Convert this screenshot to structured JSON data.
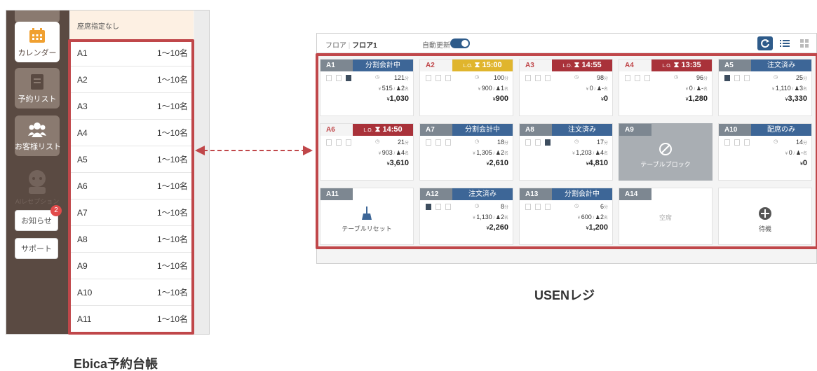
{
  "ebica": {
    "caption": "Ebica予約台帳",
    "sidebar": {
      "calendar": "カレンダー",
      "reservations": "予約リスト",
      "customers": "お客様リスト",
      "ai": "AIレセプション",
      "notice": "お知らせ",
      "notice_badge": "2",
      "support": "サポート"
    },
    "no_seat": "座席指定なし",
    "seats": [
      {
        "name": "A1",
        "capacity": "1〜10名"
      },
      {
        "name": "A2",
        "capacity": "1〜10名"
      },
      {
        "name": "A3",
        "capacity": "1〜10名"
      },
      {
        "name": "A4",
        "capacity": "1〜10名"
      },
      {
        "name": "A5",
        "capacity": "1〜10名"
      },
      {
        "name": "A6",
        "capacity": "1〜10名"
      },
      {
        "name": "A7",
        "capacity": "1〜10名"
      },
      {
        "name": "A8",
        "capacity": "1〜10名"
      },
      {
        "name": "A9",
        "capacity": "1〜10名"
      },
      {
        "name": "A10",
        "capacity": "1〜10名"
      },
      {
        "name": "A11",
        "capacity": "1〜10名"
      }
    ]
  },
  "usen": {
    "caption": "USENレジ",
    "floor_label": "フロア",
    "floor_name": "フロア1",
    "auto_update": "自動更新",
    "tables": [
      {
        "id": "A1",
        "status": "分割会計中",
        "status_color": "blue",
        "minutes": "121",
        "amount": "515",
        "guests": "2",
        "total": "1,030",
        "icons": [
          0,
          0,
          1
        ]
      },
      {
        "id": "A2",
        "status": "15:00",
        "lo": "L.O.",
        "status_color": "yellow",
        "minutes": "100",
        "amount": "900",
        "guests": "1",
        "total": "900",
        "icons": [
          0,
          0,
          0
        ]
      },
      {
        "id": "A3",
        "status": "14:55",
        "lo": "L.O.",
        "status_color": "red",
        "minutes": "98",
        "amount": "0",
        "guests": "-",
        "total": "0",
        "icons": [
          0,
          0,
          0
        ]
      },
      {
        "id": "A4",
        "status": "13:35",
        "lo": "L.O.",
        "status_color": "red",
        "minutes": "96",
        "amount": "0",
        "guests": "-",
        "total": "1,280",
        "icons": [
          0,
          0,
          0
        ]
      },
      {
        "id": "A5",
        "status": "注文済み",
        "status_color": "blue",
        "minutes": "25",
        "amount": "1,110",
        "guests": "3",
        "total": "3,330",
        "icons": [
          1,
          0,
          0
        ]
      },
      {
        "id": "A6",
        "status": "14:50",
        "lo": "L.O.",
        "status_color": "red",
        "minutes": "21",
        "amount": "903",
        "guests": "4",
        "total": "3,610",
        "icons": [
          0,
          0,
          0
        ]
      },
      {
        "id": "A7",
        "status": "分割会計中",
        "status_color": "blue",
        "minutes": "18",
        "amount": "1,305",
        "guests": "2",
        "total": "2,610",
        "icons": [
          0,
          0,
          0
        ]
      },
      {
        "id": "A8",
        "status": "注文済み",
        "status_color": "blue",
        "minutes": "17",
        "amount": "1,203",
        "guests": "4",
        "total": "4,810",
        "icons": [
          0,
          0,
          1
        ]
      },
      {
        "id": "A9",
        "status": "",
        "status_color": "none",
        "message": "テーブルブロック",
        "type": "block"
      },
      {
        "id": "A10",
        "status": "配席のみ",
        "status_color": "blue",
        "minutes": "14",
        "amount": "0",
        "guests": "-",
        "total": "0",
        "icons": [
          0,
          0,
          0
        ]
      },
      {
        "id": "A11",
        "status": "",
        "status_color": "none",
        "message": "テーブルリセット",
        "type": "reset"
      },
      {
        "id": "A12",
        "status": "注文済み",
        "status_color": "blue",
        "minutes": "8",
        "amount": "1,130",
        "guests": "2",
        "total": "2,260",
        "icons": [
          1,
          0,
          0
        ]
      },
      {
        "id": "A13",
        "status": "分割会計中",
        "status_color": "blue",
        "minutes": "6",
        "amount": "600",
        "guests": "2",
        "total": "1,200",
        "icons": [
          0,
          0,
          0
        ]
      },
      {
        "id": "A14",
        "status": "",
        "status_color": "none",
        "message": "空席",
        "type": "empty"
      },
      {
        "id": "",
        "status": "",
        "status_color": "none",
        "message": "待機",
        "type": "add"
      }
    ]
  }
}
